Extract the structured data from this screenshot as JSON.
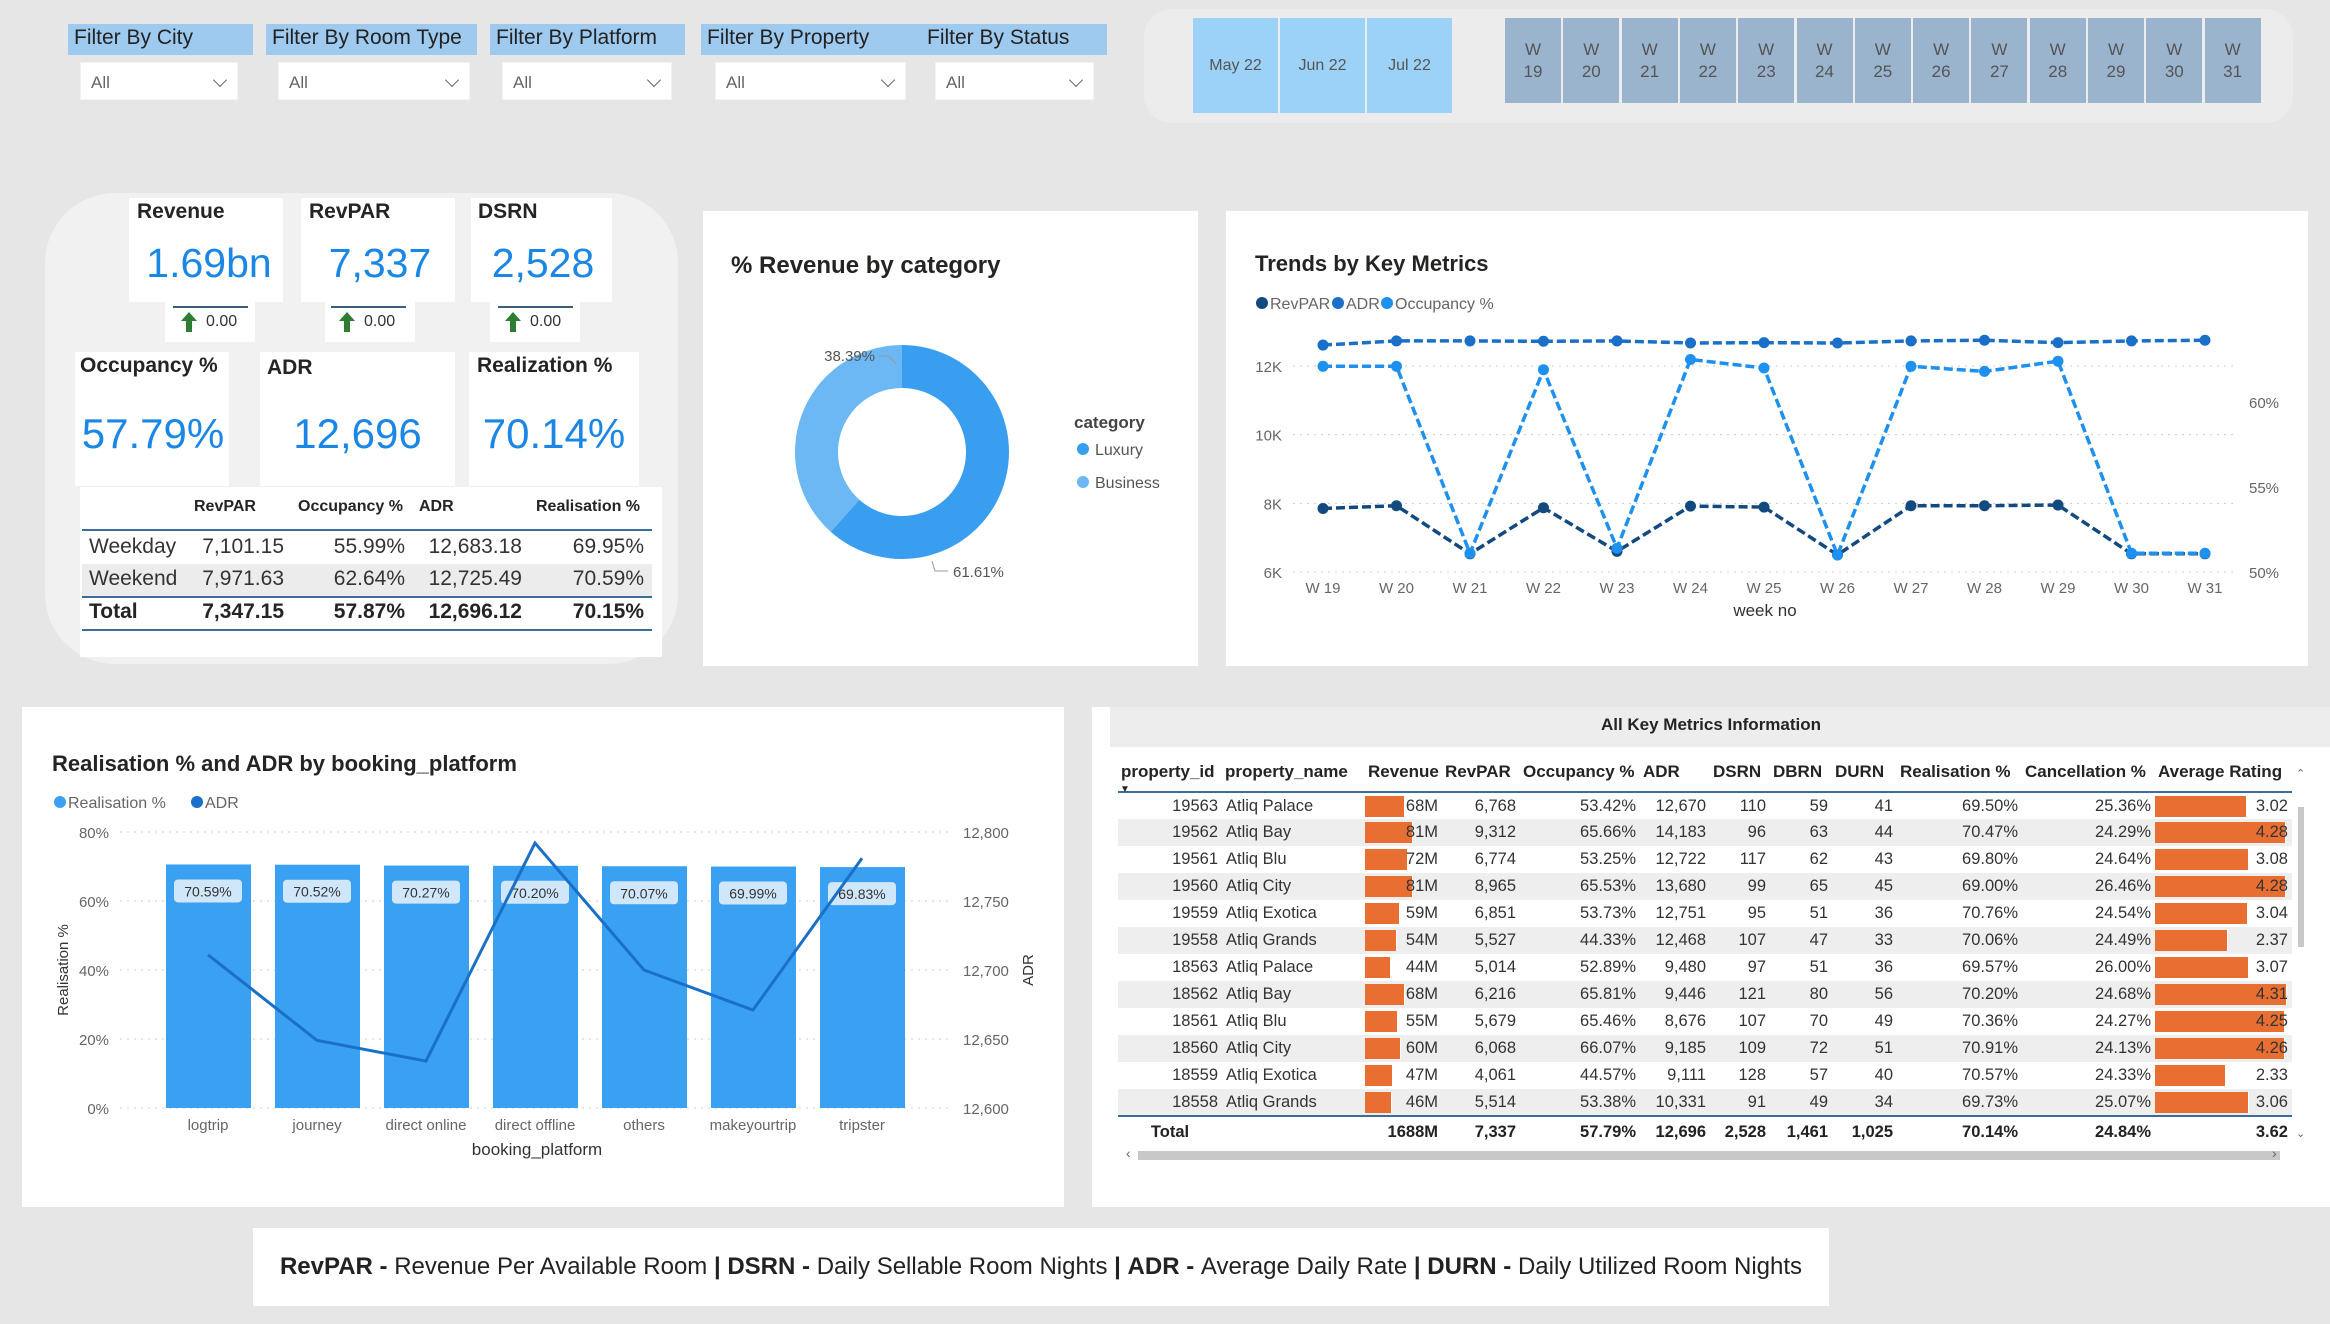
{
  "filters": [
    {
      "label": "Filter By City",
      "value": "All"
    },
    {
      "label": "Filter By Room Type",
      "value": "All"
    },
    {
      "label": "Filter By Platform",
      "value": "All"
    },
    {
      "label": "Filter By Property",
      "value": "All"
    },
    {
      "label": "Filter By Status",
      "value": "All"
    }
  ],
  "date_slicer": {
    "months": [
      "May 22",
      "Jun 22",
      "Jul 22"
    ],
    "weeks": [
      "W 19",
      "W 20",
      "W 21",
      "W 22",
      "W 23",
      "W 24",
      "W 25",
      "W 26",
      "W 27",
      "W 28",
      "W 29",
      "W 30",
      "W 31"
    ],
    "colors": {
      "month": "#9dd2f8",
      "week": "#9ab4ce"
    }
  },
  "kpis": {
    "revenue": {
      "title": "Revenue",
      "value": "1.69bn",
      "delta": "0.00"
    },
    "revpar": {
      "title": "RevPAR",
      "value": "7,337",
      "delta": "0.00"
    },
    "dsrn": {
      "title": "DSRN",
      "value": "2,528",
      "delta": "0.00"
    },
    "occupancy": {
      "title": "Occupancy %",
      "value": "57.79%"
    },
    "adr": {
      "title": "ADR",
      "value": "12,696"
    },
    "realization": {
      "title": "Realization %",
      "value": "70.14%"
    },
    "value_color": "#1a86e6"
  },
  "daytype_table": {
    "headers": [
      "RevPAR",
      "Occupancy %",
      "ADR",
      "Realisation %"
    ],
    "rows": [
      {
        "label": "Weekday",
        "values": [
          "7,101.15",
          "55.99%",
          "12,683.18",
          "69.95%"
        ]
      },
      {
        "label": "Weekend",
        "values": [
          "7,971.63",
          "62.64%",
          "12,725.49",
          "70.59%"
        ]
      }
    ],
    "total": {
      "label": "Total",
      "values": [
        "7,347.15",
        "57.87%",
        "12,696.12",
        "70.15%"
      ]
    }
  },
  "chart_data": [
    {
      "type": "pie",
      "title": "% Revenue by category",
      "legend_title": "category",
      "legend_position": "right",
      "categories": [
        "Luxury",
        "Business"
      ],
      "values": [
        61.61,
        38.39
      ],
      "labels": [
        "61.61%",
        "38.39%"
      ],
      "colors": [
        "#3a9ef0",
        "#6cb8f5"
      ]
    },
    {
      "type": "line",
      "title": "Trends by Key Metrics",
      "xlabel": "week no",
      "categories": [
        "W 19",
        "W 20",
        "W 21",
        "W 22",
        "W 23",
        "W 24",
        "W 25",
        "W 26",
        "W 27",
        "W 28",
        "W 29",
        "W 30",
        "W 31"
      ],
      "y_ticks": [
        "6K",
        "8K",
        "10K",
        "12K"
      ],
      "y_range": [
        6000,
        12000
      ],
      "y2_ticks": [
        "50%",
        "55%",
        "60%"
      ],
      "y2_range": [
        50,
        60
      ],
      "grid": true,
      "legend_position": "top-left",
      "series": [
        {
          "name": "RevPAR",
          "axis": "left",
          "color": "#124a80",
          "values": [
            7850,
            7930,
            6530,
            7870,
            6600,
            7920,
            7890,
            6500,
            7930,
            7930,
            7950,
            6530,
            6530
          ]
        },
        {
          "name": "ADR",
          "axis": "left",
          "color": "#1a6fc9",
          "values": [
            12610,
            12730,
            12730,
            12720,
            12730,
            12670,
            12680,
            12670,
            12730,
            12750,
            12680,
            12730,
            12750
          ]
        },
        {
          "name": "Occupancy %",
          "axis": "right",
          "color": "#1e90f0",
          "values": [
            62.1,
            62.1,
            51.1,
            61.9,
            51.4,
            62.5,
            62.0,
            51.0,
            62.1,
            61.8,
            62.4,
            51.1,
            51.1
          ]
        }
      ]
    },
    {
      "type": "bar",
      "title": "Realisation % and ADR by booking_platform",
      "xlabel": "booking_platform",
      "ylabel": "Realisation %",
      "y2label": "ADR",
      "categories": [
        "logtrip",
        "journey",
        "direct online",
        "direct offline",
        "others",
        "makeyourtrip",
        "tripster"
      ],
      "y_ticks": [
        "0%",
        "20%",
        "40%",
        "60%",
        "80%"
      ],
      "y_range": [
        0,
        80
      ],
      "y2_ticks": [
        "12,600",
        "12,650",
        "12,700",
        "12,750",
        "12,800"
      ],
      "y2_range": [
        12600,
        12800
      ],
      "grid": true,
      "legend_position": "top-left",
      "series": [
        {
          "name": "Realisation %",
          "kind": "bar",
          "color": "#3aa0f2",
          "values": [
            70.59,
            70.52,
            70.27,
            70.2,
            70.07,
            69.99,
            69.83
          ],
          "labels": [
            "70.59%",
            "70.52%",
            "70.27%",
            "70.20%",
            "70.07%",
            "69.99%",
            "69.83%"
          ]
        },
        {
          "name": "ADR",
          "kind": "line",
          "color": "#1a6fc9",
          "values": [
            12711,
            12649,
            12634,
            12792,
            12700,
            12671,
            12781
          ]
        }
      ]
    }
  ],
  "metrics_table": {
    "title": "All Key Metrics Information",
    "columns": [
      "property_id",
      "property_name",
      "Revenue",
      "RevPAR",
      "Occupancy %",
      "ADR",
      "DSRN",
      "DBRN",
      "DURN",
      "Realisation %",
      "Cancellation %",
      "Average Rating"
    ],
    "sort_indicator": "▼",
    "bar_color": "#e86f31",
    "rows": [
      [
        "19563",
        "Atliq Palace",
        "68M",
        "6,768",
        "53.42%",
        "12,670",
        "110",
        "59",
        "41",
        "69.50%",
        "25.36%",
        "3.02"
      ],
      [
        "19562",
        "Atliq Bay",
        "81M",
        "9,312",
        "65.66%",
        "14,183",
        "96",
        "63",
        "44",
        "70.47%",
        "24.29%",
        "4.28"
      ],
      [
        "19561",
        "Atliq Blu",
        "72M",
        "6,774",
        "53.25%",
        "12,722",
        "117",
        "62",
        "43",
        "69.80%",
        "24.64%",
        "3.08"
      ],
      [
        "19560",
        "Atliq City",
        "81M",
        "8,965",
        "65.53%",
        "13,680",
        "99",
        "65",
        "45",
        "69.00%",
        "26.46%",
        "4.28"
      ],
      [
        "19559",
        "Atliq Exotica",
        "59M",
        "6,851",
        "53.73%",
        "12,751",
        "95",
        "51",
        "36",
        "70.76%",
        "24.54%",
        "3.04"
      ],
      [
        "19558",
        "Atliq Grands",
        "54M",
        "5,527",
        "44.33%",
        "12,468",
        "107",
        "47",
        "33",
        "70.06%",
        "24.49%",
        "2.37"
      ],
      [
        "18563",
        "Atliq Palace",
        "44M",
        "5,014",
        "52.89%",
        "9,480",
        "97",
        "51",
        "36",
        "69.57%",
        "26.00%",
        "3.07"
      ],
      [
        "18562",
        "Atliq Bay",
        "68M",
        "6,216",
        "65.81%",
        "9,446",
        "121",
        "80",
        "56",
        "70.20%",
        "24.68%",
        "4.31"
      ],
      [
        "18561",
        "Atliq Blu",
        "55M",
        "5,679",
        "65.46%",
        "8,676",
        "107",
        "70",
        "49",
        "70.36%",
        "24.27%",
        "4.25"
      ],
      [
        "18560",
        "Atliq City",
        "60M",
        "6,068",
        "66.07%",
        "9,185",
        "109",
        "72",
        "51",
        "70.91%",
        "24.13%",
        "4.26"
      ],
      [
        "18559",
        "Atliq Exotica",
        "47M",
        "4,061",
        "44.57%",
        "9,111",
        "128",
        "57",
        "40",
        "70.57%",
        "24.33%",
        "2.33"
      ],
      [
        "18558",
        "Atliq Grands",
        "46M",
        "5,514",
        "53.38%",
        "10,331",
        "91",
        "49",
        "34",
        "69.73%",
        "25.07%",
        "3.06"
      ]
    ],
    "total": [
      "Total",
      "",
      "1688M",
      "7,337",
      "57.79%",
      "12,696",
      "2,528",
      "1,461",
      "1,025",
      "70.14%",
      "24.84%",
      "3.62"
    ]
  },
  "footer": {
    "items": [
      {
        "term": "RevPAR",
        "definition": "Revenue Per Available Room"
      },
      {
        "term": "DSRN",
        "definition": "Daily Sellable Room Nights"
      },
      {
        "term": "ADR",
        "definition": "Average Daily Rate"
      },
      {
        "term": "DURN",
        "definition": "Daily Utilized Room Nights"
      }
    ],
    "term_separator": " - ",
    "item_separator": " | "
  }
}
